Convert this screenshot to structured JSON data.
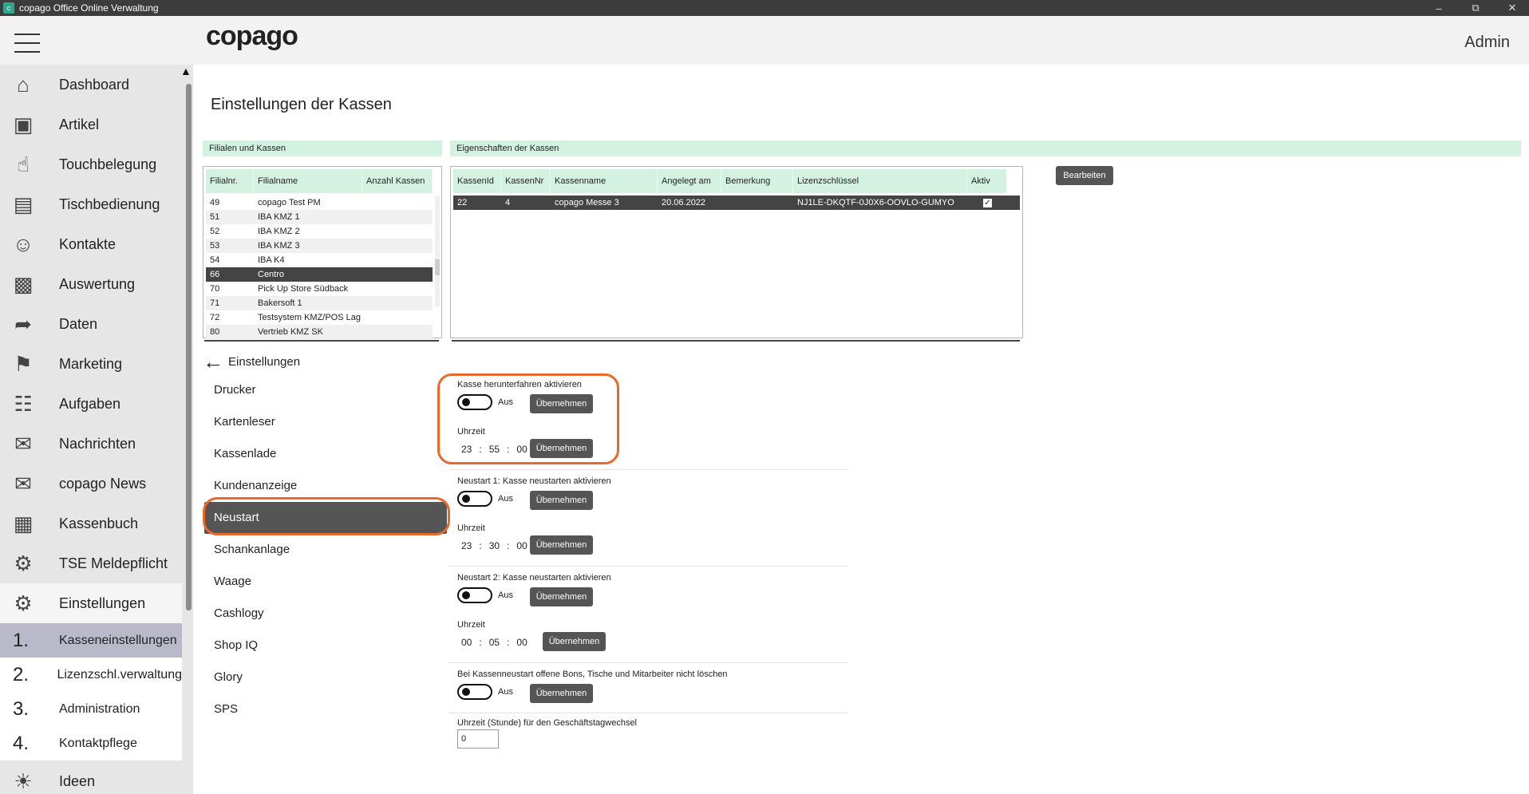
{
  "window": {
    "title": "copago Office Online Verwaltung"
  },
  "header": {
    "logo": "copago",
    "user": "Admin"
  },
  "sidebar": {
    "items": [
      {
        "label": "Dashboard",
        "icon": "home-icon"
      },
      {
        "label": "Artikel",
        "icon": "box-icon"
      },
      {
        "label": "Touchbelegung",
        "icon": "touch-hand-icon"
      },
      {
        "label": "Tischbedienung",
        "icon": "table-service-icon"
      },
      {
        "label": "Kontakte",
        "icon": "contact-card-icon"
      },
      {
        "label": "Auswertung",
        "icon": "bar-chart-icon"
      },
      {
        "label": "Daten",
        "icon": "export-arrow-icon"
      },
      {
        "label": "Marketing",
        "icon": "tag-icon"
      },
      {
        "label": "Aufgaben",
        "icon": "clipboard-icon"
      },
      {
        "label": "Nachrichten",
        "icon": "envelope-icon"
      },
      {
        "label": "copago News",
        "icon": "envelope-icon"
      },
      {
        "label": "Kassenbuch",
        "icon": "abacus-icon"
      },
      {
        "label": "TSE Meldepflicht",
        "icon": "gear-icon"
      },
      {
        "label": "Einstellungen",
        "icon": "gear-icon"
      }
    ],
    "subitems": [
      {
        "num": "1.",
        "label": "Kasseneinstellungen"
      },
      {
        "num": "2.",
        "label": "Lizenzschl.verwaltung"
      },
      {
        "num": "3.",
        "label": "Administration"
      },
      {
        "num": "4.",
        "label": "Kontaktpflege"
      }
    ],
    "last": {
      "label": "Ideen",
      "icon": "lightbulb-icon"
    }
  },
  "main": {
    "title": "Einstellungen der Kassen",
    "filialen": {
      "heading": "Filialen und Kassen",
      "columns": [
        "Filialnr.",
        "Filialname",
        "Anzahl Kassen"
      ],
      "rows": [
        {
          "nr": "49",
          "name": "copago Test PM",
          "count": ""
        },
        {
          "nr": "51",
          "name": "IBA KMZ 1",
          "count": ""
        },
        {
          "nr": "52",
          "name": "IBA KMZ 2",
          "count": ""
        },
        {
          "nr": "53",
          "name": "IBA KMZ 3",
          "count": ""
        },
        {
          "nr": "54",
          "name": "IBA K4",
          "count": ""
        },
        {
          "nr": "66",
          "name": "Centro",
          "count": ""
        },
        {
          "nr": "70",
          "name": "Pick Up Store Südback",
          "count": ""
        },
        {
          "nr": "71",
          "name": "Bakersoft 1",
          "count": ""
        },
        {
          "nr": "72",
          "name": "Testsystem KMZ/POS Lag",
          "count": ""
        },
        {
          "nr": "80",
          "name": "Vertrieb KMZ SK",
          "count": ""
        }
      ],
      "selected_index": 5
    },
    "kassen": {
      "heading": "Eigenschaften der Kassen",
      "columns": [
        "KassenId",
        "KassenNr",
        "Kassenname",
        "Angelegt am",
        "Bemerkung",
        "Lizenzschlüssel",
        "Aktiv"
      ],
      "rows": [
        {
          "id": "22",
          "nr": "4",
          "name": "copago Messe 3",
          "date": "20.06.2022",
          "note": "",
          "key": "NJ1LE-DKQTF-0J0X6-OOVLO-GUMYO",
          "active": true
        }
      ]
    },
    "edit_button": "Bearbeiten",
    "back_label": "Einstellungen",
    "settings_nav": [
      "Drucker",
      "Kartenleser",
      "Kassenlade",
      "Kundenanzeige",
      "Neustart",
      "Schankanlage",
      "Waage",
      "Cashlogy",
      "Shop IQ",
      "Glory",
      "SPS"
    ],
    "settings_nav_selected": 4,
    "panel": {
      "shutdown_label": "Kasse herunterfahren aktivieren",
      "restart1_label": "Neustart 1: Kasse neustarten aktivieren",
      "restart2_label": "Neustart 2: Kasse neustarten aktivieren",
      "keep_label": "Bei Kassenneustart offene Bons, Tische und Mitarbeiter nicht löschen",
      "daychange_label": "Uhrzeit (Stunde) für den Geschäftstagwechsel",
      "daychange_value": "0",
      "off_text": "Aus",
      "time_label": "Uhrzeit",
      "apply": "Übernehmen",
      "time_shutdown": {
        "h": "23",
        "m": "55",
        "s": "00"
      },
      "time_restart1": {
        "h": "23",
        "m": "30",
        "s": "00"
      },
      "time_restart2": {
        "h": "00",
        "m": "05",
        "s": "00"
      },
      "colon": ":"
    }
  },
  "colors": {
    "accent_green": "#d4f2e2",
    "highlight_orange": "#e8692a",
    "selected_dark": "#444444"
  }
}
